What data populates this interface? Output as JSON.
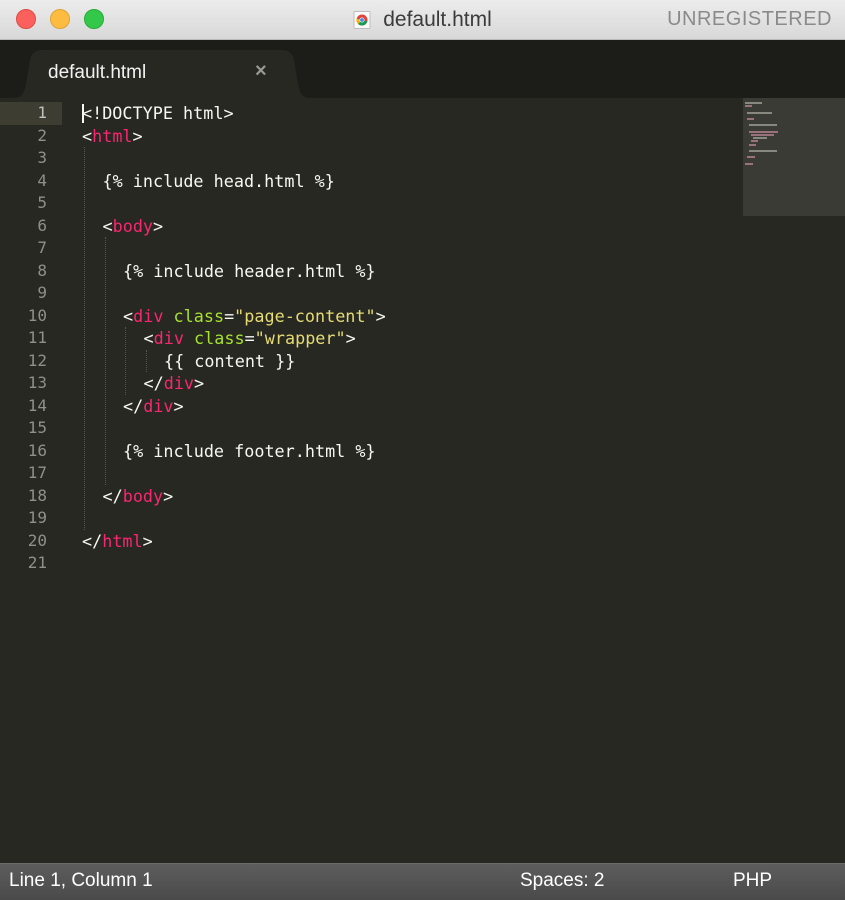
{
  "window": {
    "title": "default.html",
    "registration": "UNREGISTERED"
  },
  "tab": {
    "label": "default.html",
    "close_glyph": "×"
  },
  "editor": {
    "line_numbers": [
      "1",
      "2",
      "3",
      "4",
      "5",
      "6",
      "7",
      "8",
      "9",
      "10",
      "11",
      "12",
      "13",
      "14",
      "15",
      "16",
      "17",
      "18",
      "19",
      "20",
      "21"
    ],
    "active_line": 1,
    "lines": [
      [
        {
          "t": "<!DOCTYPE html>",
          "c": "plain"
        }
      ],
      [
        {
          "t": "<",
          "c": "plain"
        },
        {
          "t": "html",
          "c": "tag"
        },
        {
          "t": ">",
          "c": "plain"
        }
      ],
      [],
      [
        {
          "t": "{% include head.html %}",
          "c": "plain"
        }
      ],
      [],
      [
        {
          "t": "<",
          "c": "plain"
        },
        {
          "t": "body",
          "c": "tag"
        },
        {
          "t": ">",
          "c": "plain"
        }
      ],
      [],
      [
        {
          "t": "{% include header.html %}",
          "c": "plain"
        }
      ],
      [],
      [
        {
          "t": "<",
          "c": "plain"
        },
        {
          "t": "div",
          "c": "tag"
        },
        {
          "t": " ",
          "c": "plain"
        },
        {
          "t": "class",
          "c": "attr"
        },
        {
          "t": "=",
          "c": "plain"
        },
        {
          "t": "\"page-content\"",
          "c": "str"
        },
        {
          "t": ">",
          "c": "plain"
        }
      ],
      [
        {
          "t": "<",
          "c": "plain"
        },
        {
          "t": "div",
          "c": "tag"
        },
        {
          "t": " ",
          "c": "plain"
        },
        {
          "t": "class",
          "c": "attr"
        },
        {
          "t": "=",
          "c": "plain"
        },
        {
          "t": "\"wrapper\"",
          "c": "str"
        },
        {
          "t": ">",
          "c": "plain"
        }
      ],
      [
        {
          "t": "{{ content }}",
          "c": "plain"
        }
      ],
      [
        {
          "t": "</",
          "c": "plain"
        },
        {
          "t": "div",
          "c": "tag"
        },
        {
          "t": ">",
          "c": "plain"
        }
      ],
      [
        {
          "t": "</",
          "c": "plain"
        },
        {
          "t": "div",
          "c": "tag"
        },
        {
          "t": ">",
          "c": "plain"
        }
      ],
      [],
      [
        {
          "t": "{% include footer.html %}",
          "c": "plain"
        }
      ],
      [],
      [
        {
          "t": "</",
          "c": "plain"
        },
        {
          "t": "body",
          "c": "tag"
        },
        {
          "t": ">",
          "c": "plain"
        }
      ],
      [],
      [
        {
          "t": "</",
          "c": "plain"
        },
        {
          "t": "html",
          "c": "tag"
        },
        {
          "t": ">",
          "c": "plain"
        }
      ],
      []
    ],
    "indents": [
      0,
      0,
      0,
      1,
      0,
      1,
      0,
      2,
      0,
      2,
      3,
      4,
      3,
      2,
      0,
      2,
      0,
      1,
      0,
      0,
      0
    ]
  },
  "colors": {
    "background": "#272822",
    "foreground": "#f8f8f2",
    "tag": "#f92672",
    "attribute": "#a6e22e",
    "string": "#e6db74",
    "line_number": "#8f908a"
  },
  "status": {
    "position": "Line 1, Column 1",
    "spaces": "Spaces: 2",
    "syntax": "PHP"
  },
  "icons": [
    "chrome-file-icon",
    "close-icon"
  ]
}
